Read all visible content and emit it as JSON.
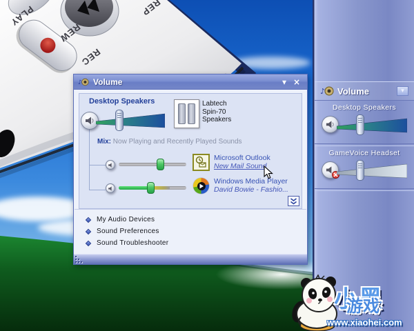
{
  "window": {
    "title": "Volume",
    "controls": {
      "collapse_glyph": "▾",
      "close_glyph": "×"
    },
    "master": {
      "label": "Desktop Speakers",
      "volume_percent": 35,
      "device_info": [
        "Labtech",
        "Spin-70",
        "Speakers"
      ]
    },
    "mix": {
      "label_bold": "Mix:",
      "label_rest": "Now Playing and Recently Played Sounds",
      "items": [
        {
          "app": "Microsoft Outlook",
          "detail": "New Mail Sound",
          "icon": "outlook-icon",
          "volume_percent": 62
        },
        {
          "app": "Windows Media Player",
          "detail": "David Bowie - Fashio...",
          "icon": "windows-media-player-icon",
          "volume_percent": 48
        }
      ]
    },
    "links": [
      {
        "label": "My Audio Devices"
      },
      {
        "label": "Sound Preferences"
      },
      {
        "label": "Sound Troubleshooter"
      }
    ]
  },
  "sidebar": {
    "title": "Volume",
    "collapse_glyph": "▾",
    "devices": [
      {
        "label": "Desktop Speakers",
        "muted": false,
        "volume_percent": 33
      },
      {
        "label": "GameVoice Headset",
        "muted": true,
        "volume_percent": 33
      }
    ]
  },
  "device_graphic": {
    "buttons": [
      {
        "label": "PLAY"
      },
      {
        "label": "REW"
      },
      {
        "label": "REC"
      },
      {
        "label": "REP"
      }
    ]
  },
  "watermark": {
    "brand_main": "小黑",
    "brand_sub": "游戏",
    "url": "www.xiaohei.com"
  },
  "colors": {
    "titlebar": "#7a8ed0",
    "panel": "#dce3f4",
    "accent_navy": "#23409a",
    "link_blue": "#3752b4",
    "wedge_green": "#35a05c",
    "wedge_blue": "#1e55a6",
    "mute_red": "#c81e1e",
    "sidebar": "#8896cc"
  }
}
